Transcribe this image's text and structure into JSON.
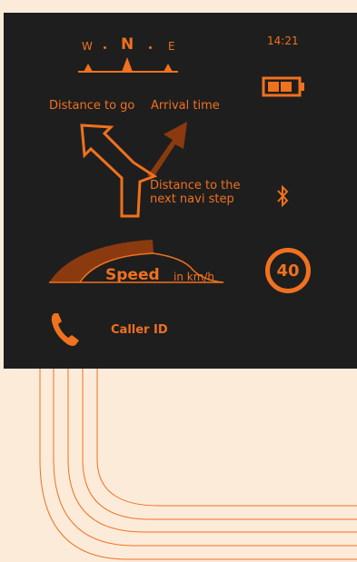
{
  "status": {
    "time": "14:21",
    "battery_level": 0.66,
    "bluetooth_icon": "bluetooth-icon"
  },
  "compass": {
    "left": "W",
    "center": "N",
    "right": "E"
  },
  "navigation": {
    "distance_to_go": "Distance to go",
    "arrival_time": "Arrival time",
    "next_step": "Distance to the next navi step",
    "turn_icon": "turn-left-fork-icon"
  },
  "speed": {
    "label": "Speed",
    "unit": "in km/h",
    "limit": "40"
  },
  "call": {
    "caller_id": "Caller ID",
    "icon": "phone-icon"
  },
  "colors": {
    "accent": "#F0711E",
    "accent_dark": "#8B3A10",
    "hud_background": "#1E1E1E",
    "page_background": "#FDEBDA"
  }
}
